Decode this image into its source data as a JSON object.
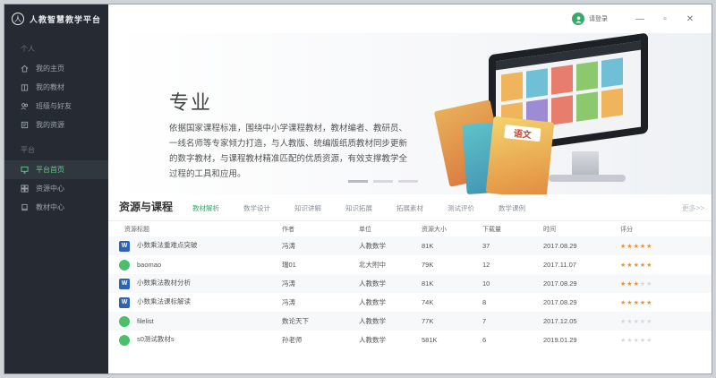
{
  "app": {
    "title": "人教智慧教学平台",
    "logo_glyph": "人"
  },
  "topbar": {
    "login_label": "请登录",
    "minimize": "—",
    "maximize": "▫",
    "close": "✕"
  },
  "sidebar": {
    "sections": [
      {
        "label": "个人",
        "items": [
          {
            "label": "我的主页",
            "icon": "home-icon",
            "active": false
          },
          {
            "label": "我的教材",
            "icon": "book-icon",
            "active": false
          },
          {
            "label": "班级与好友",
            "icon": "friends-icon",
            "active": false
          },
          {
            "label": "我的资源",
            "icon": "resource-icon",
            "active": false
          }
        ]
      },
      {
        "label": "平台",
        "items": [
          {
            "label": "平台首页",
            "icon": "platform-icon",
            "active": true
          },
          {
            "label": "资源中心",
            "icon": "resource-center-icon",
            "active": false
          },
          {
            "label": "教材中心",
            "icon": "textbook-center-icon",
            "active": false
          }
        ]
      }
    ]
  },
  "banner": {
    "title": "专业",
    "text": "依据国家课程标准，围绕中小学课程教材，教材编者、教研员、一线名师等专家倾力打造，与人教版、统编版纸质教材同步更新的数字教材，与课程教材精准匹配的优质资源，有效支撑教学全过程的工具和应用。",
    "book_label": "语文"
  },
  "resources": {
    "heading": "资源与课程",
    "tabs": [
      "教材解析",
      "数学设计",
      "知识讲解",
      "知识拓展",
      "拓展素材",
      "测试评价",
      "数学课例"
    ],
    "active_tab": 0,
    "more": "更多>>",
    "columns": [
      "资源标题",
      "作者",
      "单位",
      "资源大小",
      "下载量",
      "时间",
      "评分"
    ],
    "rows": [
      {
        "icon": "word",
        "title": "小数乘法重难点突破",
        "author": "冯涛",
        "unit": "人教数学",
        "size": "81K",
        "downloads": "37",
        "date": "2017.08.29",
        "rating": 5
      },
      {
        "icon": "img",
        "title": "baomao",
        "author": "瑞01",
        "unit": "北大附中",
        "size": "79K",
        "downloads": "12",
        "date": "2017.11.07",
        "rating": 5
      },
      {
        "icon": "word",
        "title": "小数乘法教材分析",
        "author": "冯涛",
        "unit": "人教数学",
        "size": "81K",
        "downloads": "10",
        "date": "2017.08.29",
        "rating": 3
      },
      {
        "icon": "word",
        "title": "小数乘法课标解读",
        "author": "冯涛",
        "unit": "人教数学",
        "size": "74K",
        "downloads": "8",
        "date": "2017.08.29",
        "rating": 5
      },
      {
        "icon": "img",
        "title": "filelist",
        "author": "数论天下",
        "unit": "人教数学",
        "size": "77K",
        "downloads": "7",
        "date": "2017.12.05",
        "rating": 0
      },
      {
        "icon": "img",
        "title": "s0测试教材s",
        "author": "孙老师",
        "unit": "人教数学",
        "size": "581K",
        "downloads": "6",
        "date": "2019.01.29",
        "rating": 0
      }
    ]
  },
  "colors": {
    "accent": "#3aa86a",
    "sidebar_bg": "#262b33",
    "star": "#e8932f"
  }
}
